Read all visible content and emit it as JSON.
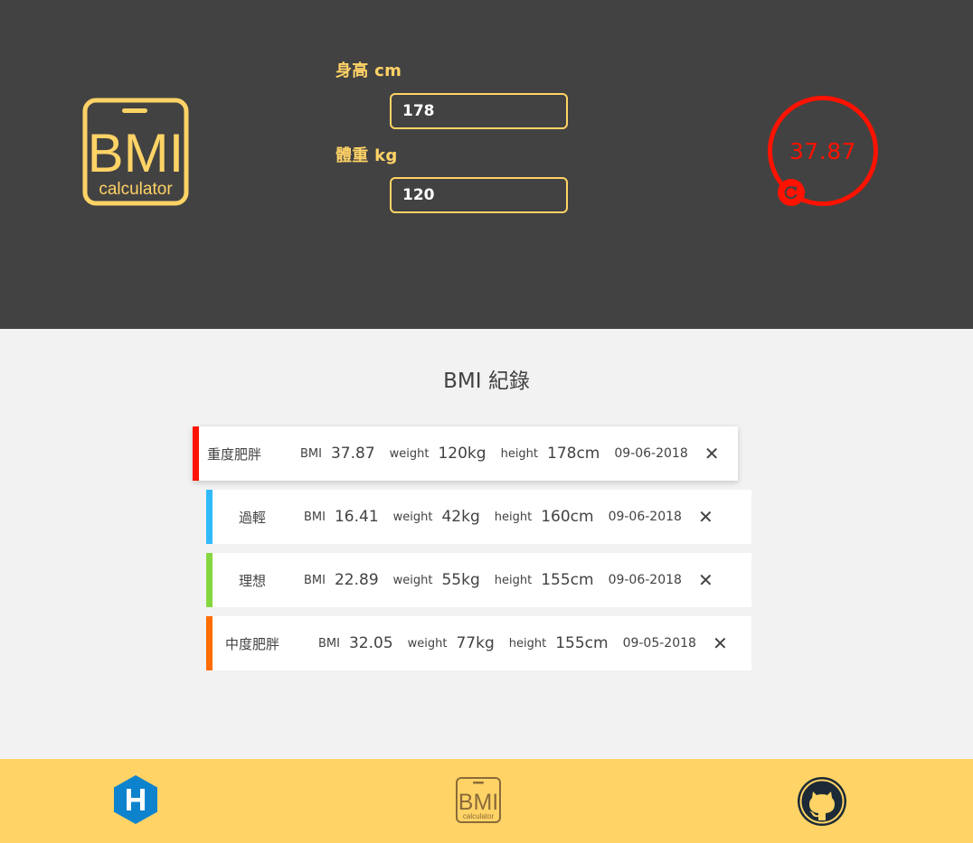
{
  "logo": {
    "line1": "BMI",
    "line2": "calculator"
  },
  "form": {
    "height_label": "身高 cm",
    "height_value": "178",
    "weight_label": "體重 kg",
    "weight_value": "120"
  },
  "result": {
    "value": "37.87",
    "color": "#ff1200"
  },
  "records": {
    "title": "BMI 紀錄",
    "items": [
      {
        "status": "重度肥胖",
        "color": "#ff1200",
        "bmi_label": "BMI",
        "bmi": "37.87",
        "weight_label": "weight",
        "weight": "120kg",
        "height_label": "height",
        "height": "178cm",
        "date": "09-06-2018"
      },
      {
        "status": "過輕",
        "color": "#31baf9",
        "bmi_label": "BMI",
        "bmi": "16.41",
        "weight_label": "weight",
        "weight": "42kg",
        "height_label": "height",
        "height": "160cm",
        "date": "09-06-2018"
      },
      {
        "status": "理想",
        "color": "#86d73f",
        "bmi_label": "BMI",
        "bmi": "22.89",
        "weight_label": "weight",
        "weight": "55kg",
        "height_label": "height",
        "height": "155cm",
        "date": "09-06-2018"
      },
      {
        "status": "中度肥胖",
        "color": "#ff6c03",
        "bmi_label": "BMI",
        "bmi": "32.05",
        "weight_label": "weight",
        "weight": "77kg",
        "height_label": "height",
        "height": "155cm",
        "date": "09-05-2018"
      }
    ],
    "delete_glyph": "✕"
  },
  "footer": {
    "left_icon": "hexo-icon",
    "center_icon": "bmi-logo-icon",
    "center_line1": "BMI",
    "center_line2": "calculator",
    "right_icon": "github-icon"
  },
  "colors": {
    "header_bg": "#424242",
    "accent": "#ffd366",
    "body_bg": "#f2f2f2",
    "hexo_blue": "#0e83cd"
  }
}
